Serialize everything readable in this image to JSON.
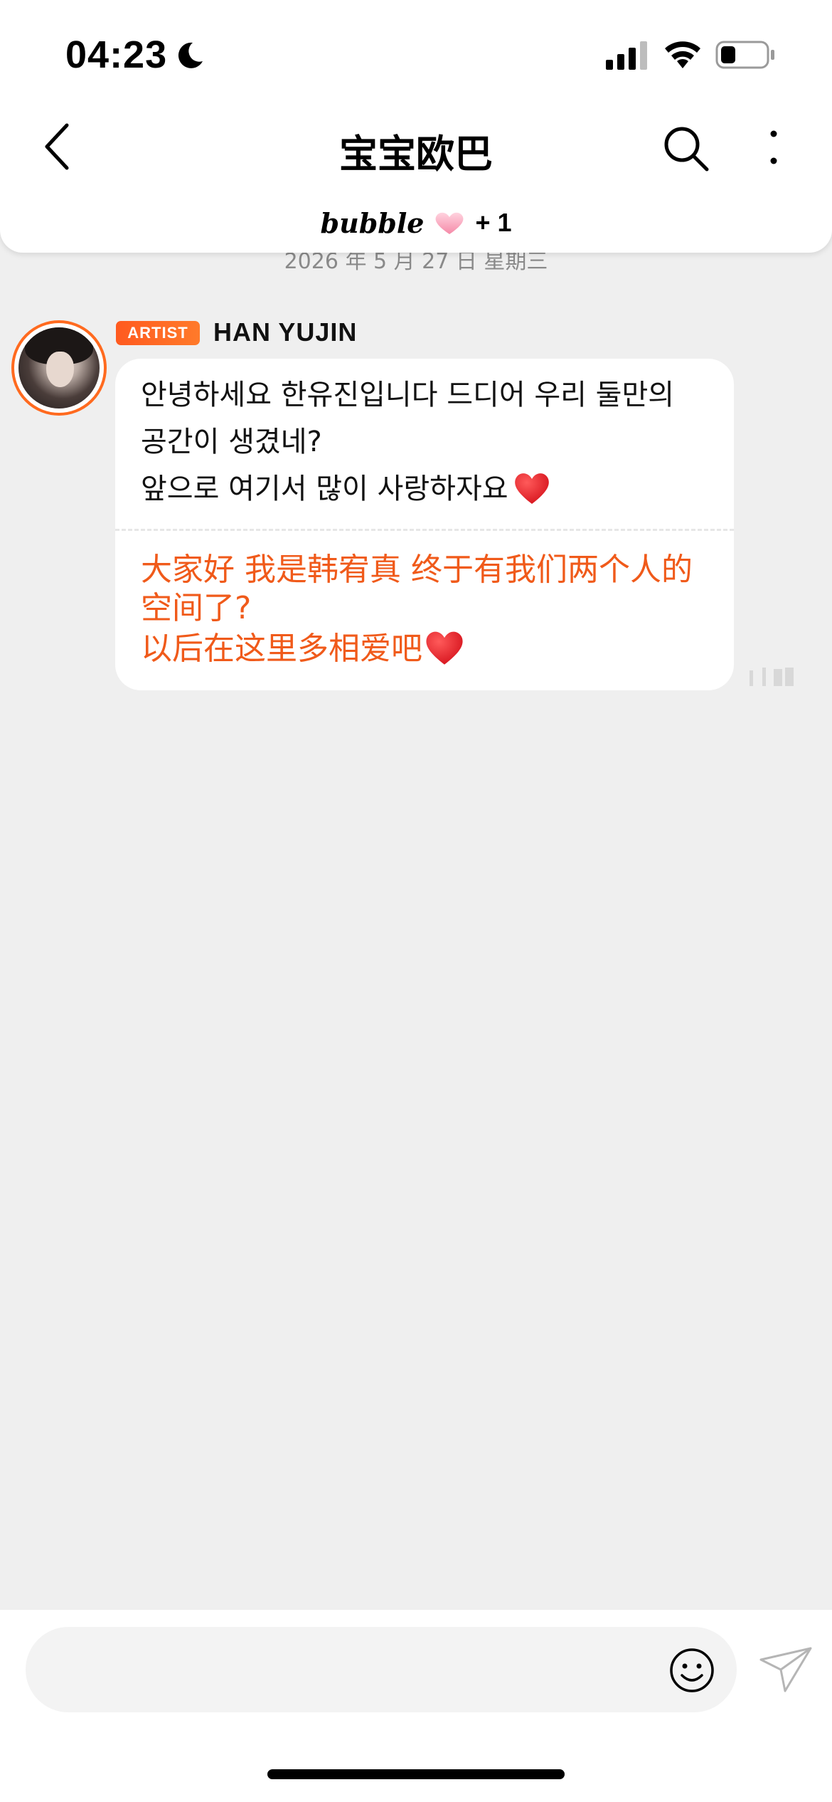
{
  "status_bar": {
    "time": "04:23"
  },
  "header": {
    "title": "宝宝欧巴",
    "brand": "bubble",
    "extra_count": "+ 1"
  },
  "chat": {
    "date": "2026 年 5 月 27 日 星期三",
    "messages": [
      {
        "badge": "ARTIST",
        "sender": "HAN YUJIN",
        "original": "안녕하세요 한유진입니다 드디어 우리 둘만의\n공간이 생겼네?\n앞으로 여기서 많이 사랑하자요",
        "translation": "大家好 我是韩宥真 终于有我们两个人的\n空间了?\n以后在这里多相爱吧"
      }
    ]
  },
  "colors": {
    "accent": "#f05a1a",
    "badge": "#ff5a1f",
    "background": "#efefef"
  },
  "icons": [
    "moon-icon",
    "signal-icon",
    "wifi-icon",
    "battery-icon",
    "back-arrow-icon",
    "search-icon",
    "more-vertical-icon",
    "heart-icon",
    "emoji-icon",
    "send-icon"
  ]
}
